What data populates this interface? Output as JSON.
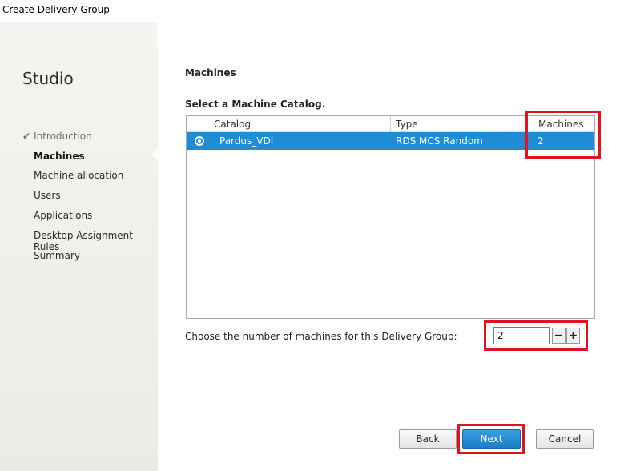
{
  "window": {
    "title": "Create Delivery Group"
  },
  "sidebar": {
    "brand": "Studio",
    "items": [
      {
        "label": "Introduction",
        "state": "done"
      },
      {
        "label": "Machines",
        "state": "active"
      },
      {
        "label": "Machine allocation",
        "state": "pending"
      },
      {
        "label": "Users",
        "state": "pending"
      },
      {
        "label": "Applications",
        "state": "pending"
      },
      {
        "label": "Desktop Assignment Rules",
        "state": "pending"
      },
      {
        "label": "Summary",
        "state": "pending"
      }
    ],
    "check_glyph": "✔"
  },
  "main": {
    "heading": "Machines",
    "subheading": "Select a Machine Catalog.",
    "table": {
      "columns": [
        "Catalog",
        "Type",
        "Machines"
      ],
      "rows": [
        {
          "selected": true,
          "catalog": "Pardus_VDI",
          "type": "RDS MCS Random",
          "machines": "2"
        }
      ]
    },
    "count_label": "Choose the number of machines for this Delivery Group:",
    "count_value": "2",
    "decrement_label": "−",
    "increment_label": "+"
  },
  "buttons": {
    "back": "Back",
    "next": "Next",
    "cancel": "Cancel"
  },
  "colors": {
    "selection": "#1f8dd6",
    "highlight_box": "#e0141e",
    "primary_button": "#1f8dd6"
  }
}
